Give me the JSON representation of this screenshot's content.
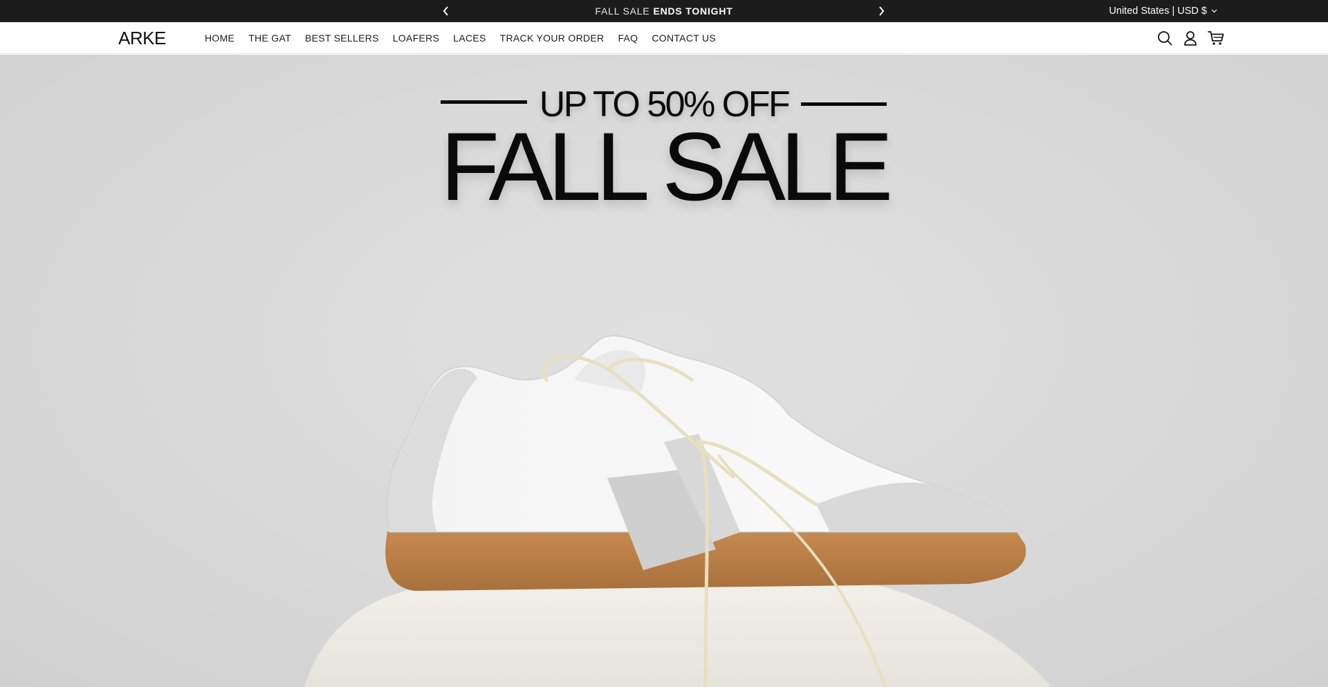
{
  "announcement": {
    "text_light": "FALL SALE",
    "text_bold": "ENDS TONIGHT",
    "prev_icon": "chevron-left-icon",
    "next_icon": "chevron-right-icon",
    "locale": "United States | USD $"
  },
  "header": {
    "logo": "ARKE",
    "nav": [
      "HOME",
      "THE GAT",
      "BEST SELLERS",
      "LOAFERS",
      "LACES",
      "TRACK YOUR ORDER",
      "FAQ",
      "CONTACT US"
    ],
    "icons": [
      "search-icon",
      "account-icon",
      "cart-icon"
    ]
  },
  "hero": {
    "subtitle": "UP TO 50% OFF",
    "title": "FALL SALE",
    "image": "white leather sneaker with grey suede panels and gum sole"
  },
  "colors": {
    "announce_bg": "#1c1c1c",
    "hero_bg": "#d9d9d9",
    "text": "#0a0a0a"
  }
}
